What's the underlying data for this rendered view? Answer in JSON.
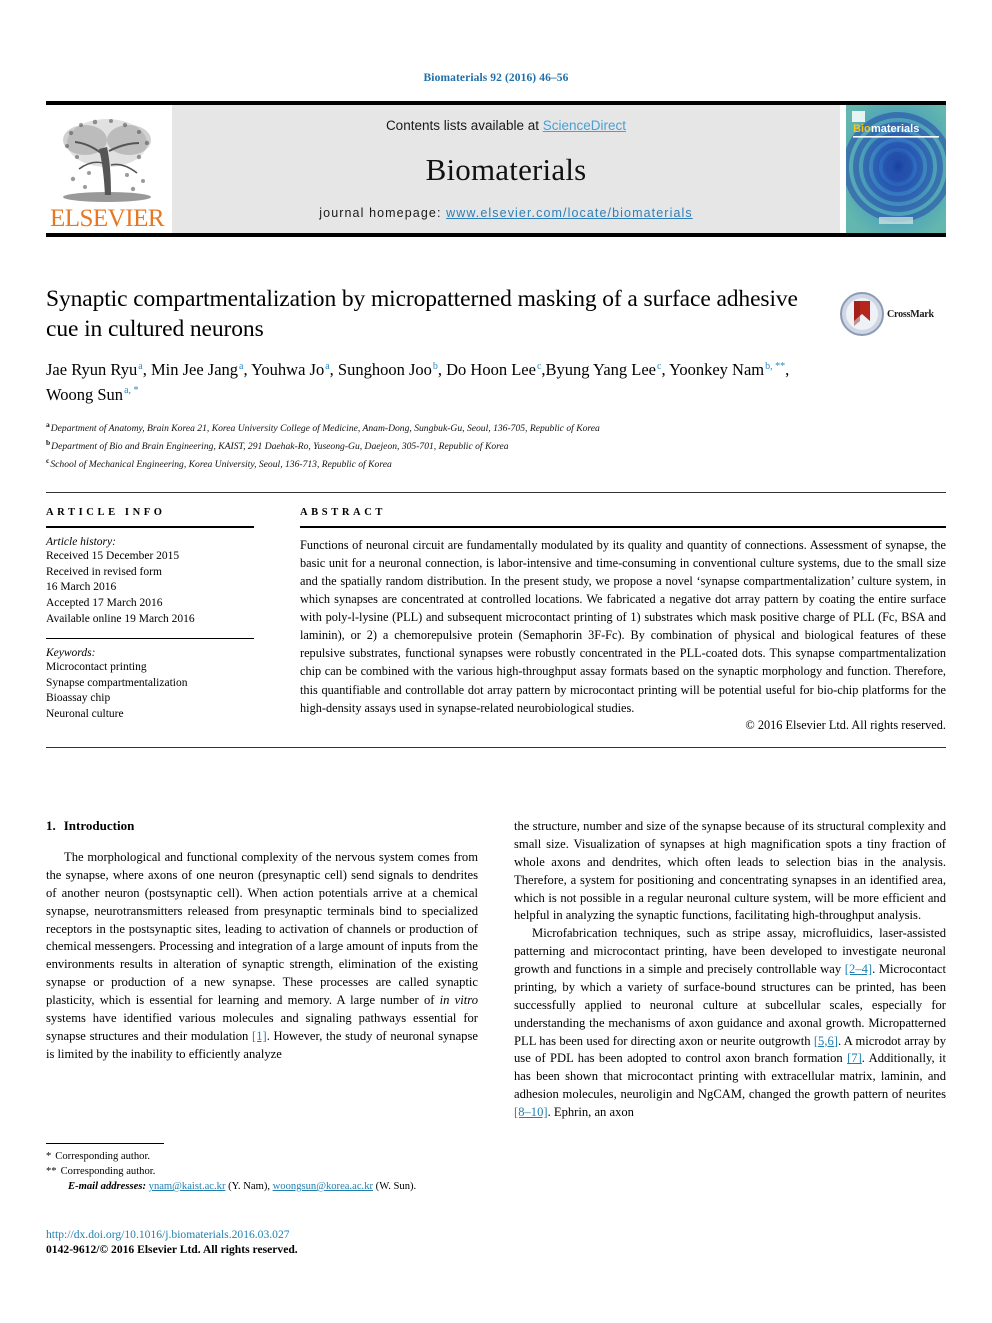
{
  "running_head": "Biomaterials 92 (2016) 46–56",
  "masthead": {
    "publisher_name": "ELSEVIER",
    "contents_prefix": "Contents lists available at ",
    "contents_link": "ScienceDirect",
    "journal_title": "Biomaterials",
    "homepage_prefix": "journal homepage: ",
    "homepage_url": "www.elsevier.com/locate/biomaterials",
    "cover_title": "Biomaterials"
  },
  "crossmark": {
    "label": "CrossMark"
  },
  "article": {
    "title": "Synaptic compartmentalization by micropatterned masking of a surface adhesive cue in cultured neurons",
    "authors_line1": "Jae Ryun Ryu ",
    "authors": [
      {
        "name": "Jae Ryun Ryu",
        "sup": "a",
        "sep": ", "
      },
      {
        "name": "Min Jee Jang",
        "sup": "a",
        "sep": ", "
      },
      {
        "name": "Youhwa Jo",
        "sup": "a",
        "sep": ", "
      },
      {
        "name": "Sunghoon Joo",
        "sup": "b",
        "sep": ", "
      },
      {
        "name": "Do Hoon Lee",
        "sup": "c",
        "sep": ","
      },
      {
        "name": "Byung Yang Lee",
        "sup": "c",
        "sep": ", "
      },
      {
        "name": "Yoonkey Nam",
        "sup": "b, **",
        "sep": ", "
      },
      {
        "name": "Woong Sun",
        "sup": "a, *",
        "sep": ""
      }
    ],
    "affiliations": [
      {
        "marker": "a",
        "text": "Department of Anatomy, Brain Korea 21, Korea University College of Medicine, Anam-Dong, Sungbuk-Gu, Seoul, 136-705, Republic of Korea"
      },
      {
        "marker": "b",
        "text": "Department of Bio and Brain Engineering, KAIST, 291 Daehak-Ro, Yuseong-Gu, Daejeon, 305-701, Republic of Korea"
      },
      {
        "marker": "c",
        "text": "School of Mechanical Engineering, Korea University, Seoul, 136-713, Republic of Korea"
      }
    ]
  },
  "article_info": {
    "heading": "ARTICLE INFO",
    "history_label": "Article history:",
    "history": [
      "Received 15 December 2015",
      "Received in revised form",
      "16 March 2016",
      "Accepted 17 March 2016",
      "Available online 19 March 2016"
    ],
    "keywords_label": "Keywords:",
    "keywords": [
      "Microcontact printing",
      "Synapse compartmentalization",
      "Bioassay chip",
      "Neuronal culture"
    ]
  },
  "abstract": {
    "heading": "ABSTRACT",
    "text": "Functions of neuronal circuit are fundamentally modulated by its quality and quantity of connections. Assessment of synapse, the basic unit for a neuronal connection, is labor-intensive and time-consuming in conventional culture systems, due to the small size and the spatially random distribution. In the present study, we propose a novel ‘synapse compartmentalization’ culture system, in which synapses are concentrated at controlled locations. We fabricated a negative dot array pattern by coating the entire surface with poly-l-lysine (PLL) and subsequent microcontact printing of 1) substrates which mask positive charge of PLL (Fc, BSA and laminin), or 2) a chemorepulsive protein (Semaphorin 3F-Fc). By combination of physical and biological features of these repulsive substrates, functional synapses were robustly concentrated in the PLL-coated dots. This synapse compartmentalization chip can be combined with the various high-throughput assay formats based on the synaptic morphology and function. Therefore, this quantifiable and controllable dot array pattern by microcontact printing will be potential useful for bio-chip platforms for the high-density assays used in synapse-related neurobiological studies.",
    "copyright": "© 2016 Elsevier Ltd. All rights reserved."
  },
  "introduction": {
    "number": "1.",
    "heading": "Introduction",
    "left_para_1_a": "The morphological and functional complexity of the nervous system comes from the synapse, where axons of one neuron (presynaptic cell) send signals to dendrites of another neuron (postsynaptic cell). When action potentials arrive at a chemical synapse, neurotransmitters released from presynaptic terminals bind to specialized receptors in the postsynaptic sites, leading to activation of channels or production of chemical messengers. Processing and integration of a large amount of inputs from the environments results in alteration of synaptic strength, elimination of the existing synapse or production of a new synapse. These processes are called synaptic plasticity, which is essential for learning and memory. A large number of ",
    "left_para_1_italic": "in vitro",
    "left_para_1_b": " systems have identified various molecules and signaling pathways essential for synapse structures and their modulation ",
    "left_ref_1": "[1]",
    "left_para_1_c": ". However, the study of neuronal synapse is limited by the inability to efficiently analyze",
    "right_para_1": "the structure, number and size of the synapse because of its structural complexity and small size. Visualization of synapses at high magnification spots a tiny fraction of whole axons and dendrites, which often leads to selection bias in the analysis. Therefore, a system for positioning and concentrating synapses in an identified area, which is not possible in a regular neuronal culture system, will be more efficient and helpful in analyzing the synaptic functions, facilitating high-throughput analysis.",
    "right_para_2_a": "Microfabrication techniques, such as stripe assay, microfluidics, laser-assisted patterning and microcontact printing, have been developed to investigate neuronal growth and functions in a simple and precisely controllable way ",
    "right_ref_1": "[2–4]",
    "right_para_2_b": ". Microcontact printing, by which a variety of surface-bound structures can be printed, has been successfully applied to neuronal culture at subcellular scales, especially for understanding the mechanisms of axon guidance and axonal growth. Micropatterned PLL has been used for directing axon or neurite outgrowth ",
    "right_ref_2": "[5,6]",
    "right_para_2_c": ". A microdot array by use of PDL has been adopted to control axon branch formation ",
    "right_ref_3": "[7]",
    "right_para_2_d": ". Additionally, it has been shown that microcontact printing with extracellular matrix, laminin, and adhesion molecules, neuroligin and NgCAM, changed the growth pattern of neurites ",
    "right_ref_4": "[8–10]",
    "right_para_2_e": ". Ephrin, an axon"
  },
  "footnotes": {
    "line1_marker": "*",
    "line1_text": "Corresponding author.",
    "line2_marker": "**",
    "line2_text": "Corresponding author.",
    "email_label": "E-mail addresses:",
    "email1": "ynam@kaist.ac.kr",
    "email1_name": " (Y. Nam), ",
    "email2": "woongsun@korea.ac.kr",
    "email2_name": " (W. Sun)."
  },
  "doi_block": {
    "doi": "http://dx.doi.org/10.1016/j.biomaterials.2016.03.027",
    "issn_line": "0142-9612/© 2016 Elsevier Ltd. All rights reserved."
  },
  "colors": {
    "link_blue": "#1f7fb0",
    "science_direct_blue": "#4a9fd4",
    "elsevier_orange": "#e87722",
    "banner_grey": "#e6e6e6"
  }
}
